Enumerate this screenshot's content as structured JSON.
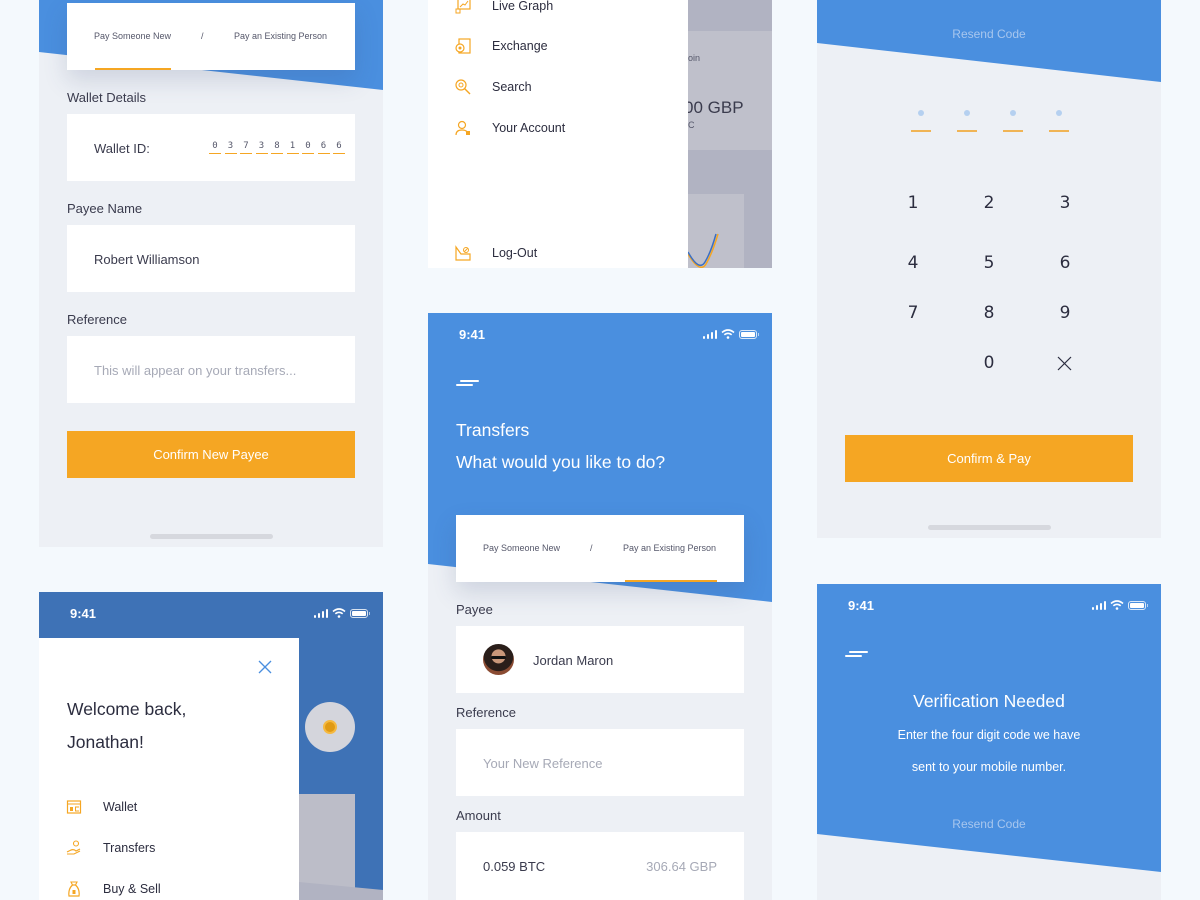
{
  "colors": {
    "primary_blue": "#4a8fdf",
    "accent_orange": "#f5a623",
    "background": "#edf0f5",
    "page_bg": "#f4f9fd"
  },
  "status_bar": {
    "time": "9:41"
  },
  "screen_new_payee": {
    "tabs": {
      "pay_new": "Pay Someone New",
      "separator": "/",
      "pay_existing": "Pay an Existing Person",
      "active": "pay_new"
    },
    "wallet_details_label": "Wallet Details",
    "wallet_id_label": "Wallet ID:",
    "wallet_id_digits": [
      "0",
      "3",
      "7",
      "3",
      "8",
      "1",
      "0",
      "6",
      "6"
    ],
    "payee_name_label": "Payee Name",
    "payee_name_value": "Robert Williamson",
    "reference_label": "Reference",
    "reference_placeholder": "This will appear on your transfers...",
    "confirm_button": "Confirm New Payee"
  },
  "screen_side_menu_top": {
    "menu_items": [
      {
        "label": "Live Graph",
        "icon": "chart-icon"
      },
      {
        "label": "Exchange",
        "icon": "exchange-icon"
      },
      {
        "label": "Search",
        "icon": "search-icon"
      },
      {
        "label": "Your Account",
        "icon": "account-icon"
      }
    ],
    "logout_label": "Log-Out",
    "background_partial": {
      "label_fragment": "oin",
      "amount_fragment": "00 GBP",
      "sub_fragment": "C"
    }
  },
  "screen_transfers": {
    "title": "Transfers",
    "subtitle": "What would you like to do?",
    "tabs": {
      "pay_new": "Pay Someone New",
      "separator": "/",
      "pay_existing": "Pay an Existing Person",
      "active": "pay_existing"
    },
    "payee_label": "Payee",
    "payee_name": "Jordan Maron",
    "reference_label": "Reference",
    "reference_placeholder": "Your New Reference",
    "amount_label": "Amount",
    "amount_btc": "0.059 BTC",
    "amount_gbp": "306.64 GBP"
  },
  "screen_keypad": {
    "resend_code": "Resend Code",
    "code_slots": 4,
    "keys": [
      "1",
      "2",
      "3",
      "4",
      "5",
      "6",
      "7",
      "8",
      "9",
      "0"
    ],
    "confirm_button": "Confirm & Pay"
  },
  "screen_welcome_menu": {
    "greeting_line1": "Welcome back,",
    "greeting_line2": "Jonathan!",
    "menu_items": [
      {
        "label": "Wallet",
        "icon": "wallet-icon"
      },
      {
        "label": "Transfers",
        "icon": "transfer-icon"
      },
      {
        "label": "Buy & Sell",
        "icon": "money-bag-icon"
      }
    ]
  },
  "screen_verification": {
    "title": "Verification Needed",
    "message_line1": "Enter the four digit code we have",
    "message_line2": "sent to your mobile number.",
    "resend_code": "Resend Code"
  }
}
